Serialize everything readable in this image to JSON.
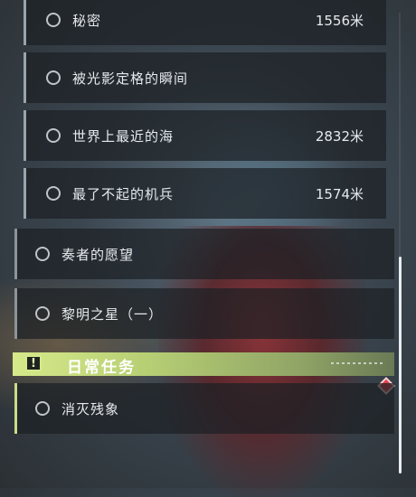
{
  "quests": {
    "sub": [
      {
        "title": "秘密",
        "distance": "1556米"
      },
      {
        "title": "被光影定格的瞬间",
        "distance": ""
      },
      {
        "title": "世界上最近的海",
        "distance": "2832米"
      },
      {
        "title": "最了不起的机兵",
        "distance": "1574米"
      }
    ],
    "main": [
      {
        "title": "奏者的愿望"
      },
      {
        "title": "黎明之星（一）"
      }
    ]
  },
  "daily": {
    "header_title": "日常任务",
    "icon_glyph": "!",
    "items": [
      {
        "title": "消灭残象"
      }
    ]
  },
  "colors": {
    "daily_accent": "#d6e98a",
    "marker_red": "#e0404a"
  }
}
